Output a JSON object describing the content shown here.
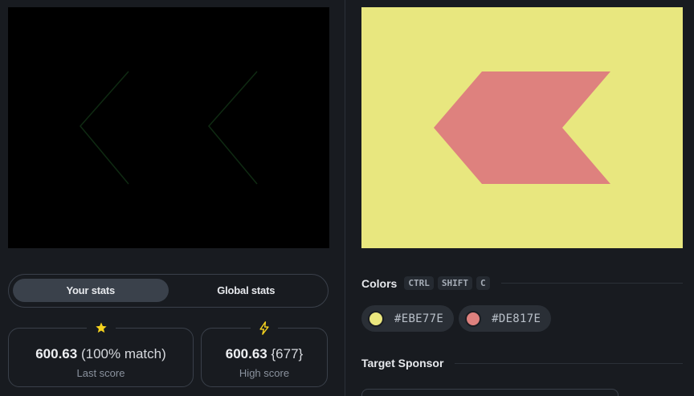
{
  "left": {
    "tabs": {
      "your_stats": "Your stats",
      "global_stats": "Global stats",
      "active": "your_stats"
    },
    "last_score": {
      "icon": "star-icon",
      "icon_color": "#f5d21e",
      "score": "600.63",
      "match": "(100% match)",
      "label": "Last score"
    },
    "high_score": {
      "icon": "lightning-icon",
      "icon_color": "#f5d21e",
      "score": "600.63",
      "detail": "{677}",
      "label": "High score"
    }
  },
  "right": {
    "target_colors": {
      "background": "#e8e77f",
      "shape": "#de817e"
    },
    "colors_section": {
      "title": "Colors",
      "shortcut": [
        "CTRL",
        "SHIFT",
        "C"
      ],
      "chips": [
        {
          "label": "#EBE77E",
          "color": "#ebe77e"
        },
        {
          "label": "#DE817E",
          "color": "#de817e"
        }
      ]
    },
    "sponsor_section": {
      "title": "Target Sponsor"
    }
  }
}
